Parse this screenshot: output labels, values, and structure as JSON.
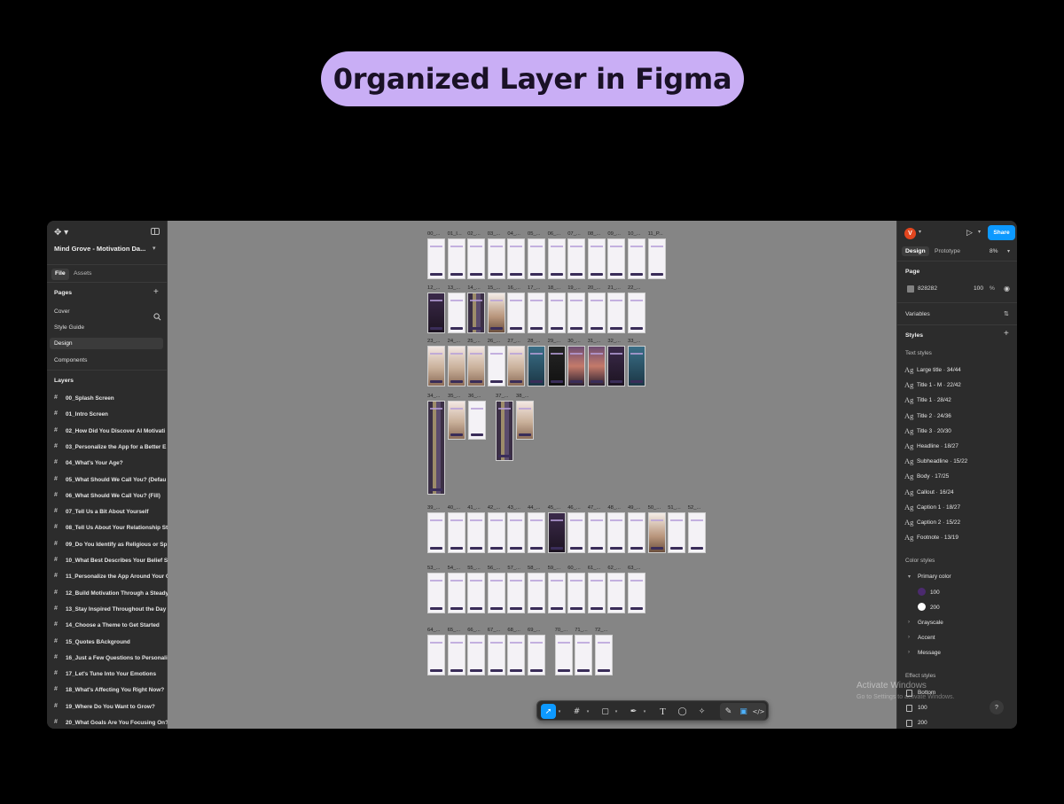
{
  "heading": "0rganized Layer in Figma",
  "file": {
    "title": "Mind Grove - Motivation Da..."
  },
  "left_tabs": {
    "file": "File",
    "assets": "Assets"
  },
  "pages": {
    "label": "Pages",
    "items": [
      "Cover",
      "Style Guide",
      "Design",
      "Components"
    ],
    "selected": "Design"
  },
  "layers": {
    "label": "Layers",
    "items": [
      "00_Splash Screen",
      "01_Intro Screen",
      "02_How Did You Discover AI Motivati",
      "03_Personalize the App for a Better E",
      "04_What's Your Age?",
      "05_What Should We Call You? (Defau",
      "06_What Should We Call You? (Fill)",
      "07_Tell Us a Bit About Yourself",
      "08_Tell Us About Your Relationship St",
      "09_Do You Identify as Religious or Sp",
      "10_What Best Describes Your Belief S",
      "11_Personalize the App Around Your G",
      "12_Build Motivation Through a Steady",
      "13_Stay Inspired Throughout the Day",
      "14_Choose a Theme to Get Started",
      "15_Quotes BAckground",
      "16_Just a Few Questions to Personali",
      "17_Let's Tune Into Your Emotions",
      "18_What's Affecting You Right Now?",
      "19_Where Do You Want to Grow?",
      "20_What Goals Are You Focusing On?"
    ]
  },
  "canvas": {
    "rows": [
      {
        "labels": [
          "00_...",
          "01_I...",
          "02_...",
          "03_...",
          "04_...",
          "05_...",
          "06_...",
          "07_...",
          "08_...",
          "09_...",
          "10_...",
          "11_P..."
        ]
      },
      {
        "labels": [
          "12_...",
          "13_...",
          "14_...",
          "15_...",
          "16_...",
          "17_...",
          "18_...",
          "19_...",
          "20_...",
          "21_...",
          "22_..."
        ]
      },
      {
        "labels": [
          "23_...",
          "24_...",
          "25_...",
          "26_...",
          "27_...",
          "28_...",
          "29_...",
          "30_...",
          "31_...",
          "32_...",
          "33_..."
        ]
      },
      {
        "labels": [
          "34_...",
          "35_...",
          "36_...",
          "37_...",
          "38_..."
        ]
      },
      {
        "labels": [
          "39_...",
          "40_...",
          "41_...",
          "42_...",
          "43_...",
          "44_...",
          "45_...",
          "46_...",
          "47_...",
          "48_...",
          "49_...",
          "50_...",
          "51_...",
          "52_..."
        ]
      },
      {
        "labels": [
          "53_...",
          "54_...",
          "55_...",
          "56_...",
          "57_...",
          "58_...",
          "59_...",
          "60_...",
          "61_...",
          "62_...",
          "63_..."
        ]
      },
      {
        "labels": [
          "64_...",
          "65_...",
          "66_...",
          "67_...",
          "68_...",
          "69_...",
          "70_...",
          "71_...",
          "72_..."
        ]
      }
    ]
  },
  "toolbar": {
    "tools": [
      "move-tool",
      "frame-tool",
      "shape-tool",
      "pen-tool",
      "text-tool",
      "comment-tool",
      "actions-tool",
      "draw-mode",
      "design-mode",
      "dev-mode"
    ],
    "active": "move-tool"
  },
  "right": {
    "avatar": "V",
    "share": "Share",
    "tabs": {
      "design": "Design",
      "prototype": "Prototype"
    },
    "zoom": "8%",
    "page_section": "Page",
    "page_color": "828282",
    "page_opacity": "100",
    "page_opacity_unit": "%",
    "variables": "Variables",
    "styles": "Styles",
    "text_styles_label": "Text styles",
    "text_styles": [
      "Large title · 34/44",
      "Title 1 - M · 22/42",
      "Title 1 · 28/42",
      "Title 2 · 24/36",
      "Title 3 · 20/30",
      "Headline · 18/27",
      "Subheadline · 15/22",
      "Body · 17/25",
      "Callout · 16/24",
      "Caption 1 · 18/27",
      "Caption 2 · 15/22",
      "Footnote · 13/19"
    ],
    "color_styles_label": "Color styles",
    "color_groups": [
      "Primary color",
      "Grayscale",
      "Accent",
      "Message"
    ],
    "primary_swatches": [
      {
        "label": "100",
        "color": "#4b2a6e"
      },
      {
        "label": "200",
        "color": "#ffffff"
      }
    ],
    "effect_styles_label": "Effect styles",
    "effect_styles": [
      "Bottom",
      "100",
      "200"
    ],
    "help": "?"
  },
  "watermark": {
    "line1": "Activate Windows",
    "line2": "Go to Settings to activate Windows."
  },
  "colors": {
    "accent": "#0d99ff",
    "pill": "#c9aef5",
    "canvas_bg": "#858585",
    "panel_bg": "#2c2c2c"
  }
}
